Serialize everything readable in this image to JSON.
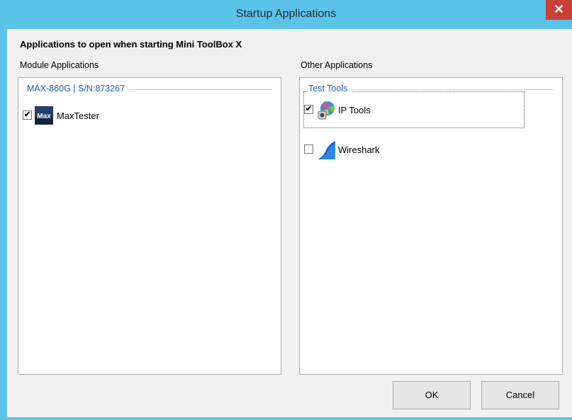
{
  "window": {
    "title": "Startup Applications",
    "close_glyph": "✕"
  },
  "heading": "Applications to open when starting Mini ToolBox X",
  "module_panel": {
    "label": "Module Applications",
    "group_title": "MAX-860G | S/N:873267",
    "items": [
      {
        "label": "MaxTester",
        "checked": true,
        "icon": "maxtester-icon",
        "icon_text": "Max"
      }
    ]
  },
  "other_panel": {
    "label": "Other Applications",
    "group_title": "Test Tools",
    "items": [
      {
        "label": "IP Tools",
        "checked": true,
        "icon": "ip-tools-icon"
      },
      {
        "label": "Wireshark",
        "checked": false,
        "icon": "wireshark-icon"
      }
    ]
  },
  "buttons": {
    "ok": "OK",
    "cancel": "Cancel"
  },
  "colors": {
    "title_bar": "#5cc3e8",
    "close": "#c7403a",
    "group_title": "#1f5fb7"
  },
  "checkmark_glyph": "✔"
}
